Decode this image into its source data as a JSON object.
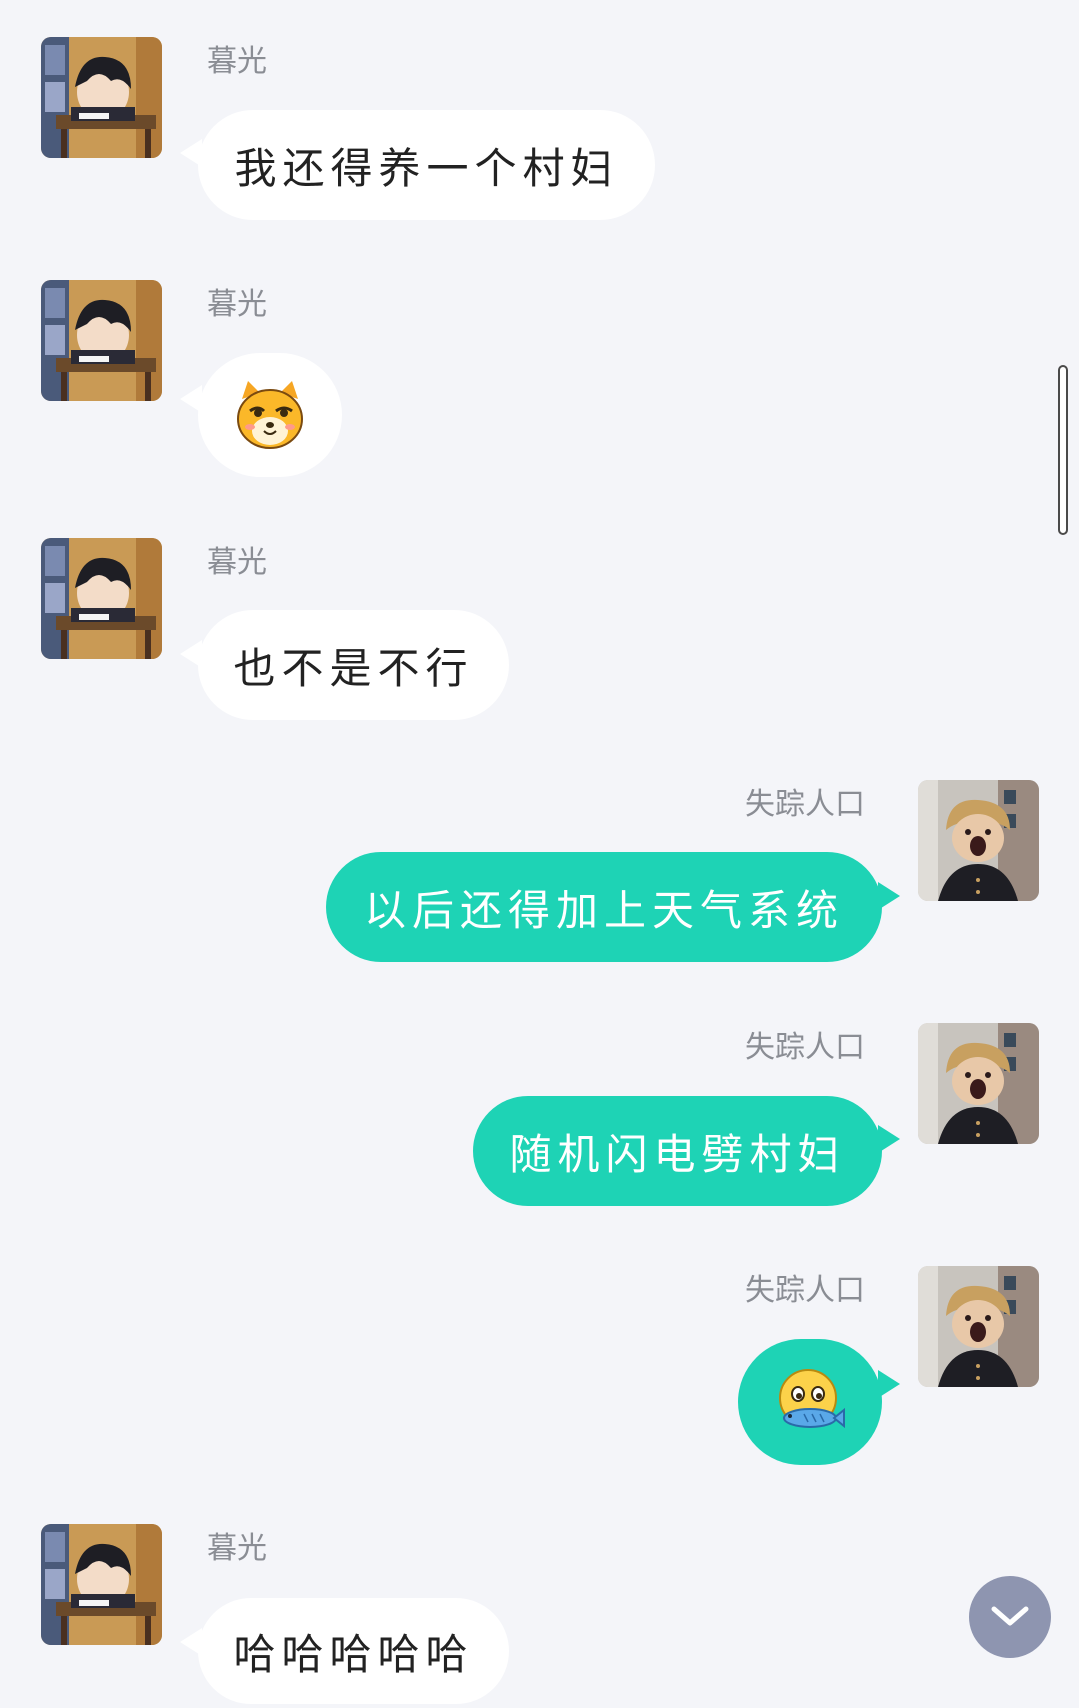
{
  "messages": [
    {
      "sender": "暮光",
      "side": "left",
      "type": "text",
      "text": "我还得养一个村妇"
    },
    {
      "sender": "暮光",
      "side": "left",
      "type": "sticker",
      "icon": "shiba-dog-smirk-icon"
    },
    {
      "sender": "暮光",
      "side": "left",
      "type": "text",
      "text": "也不是不行"
    },
    {
      "sender": "失踪人口",
      "side": "right",
      "type": "text",
      "text": "以后还得加上天气系统"
    },
    {
      "sender": "失踪人口",
      "side": "right",
      "type": "text",
      "text": "随机闪电劈村妇"
    },
    {
      "sender": "失踪人口",
      "side": "right",
      "type": "sticker",
      "icon": "face-biting-fish-icon"
    },
    {
      "sender": "暮光",
      "side": "left",
      "type": "text",
      "text": "哈哈哈哈哈"
    }
  ],
  "colors": {
    "background": "#f4f5f9",
    "incoming_bubble": "#ffffff",
    "outgoing_bubble": "#1ed3b5",
    "scroll_button": "#8e95b0"
  },
  "controls": {
    "scroll_to_bottom_icon": "chevron-down-icon"
  }
}
